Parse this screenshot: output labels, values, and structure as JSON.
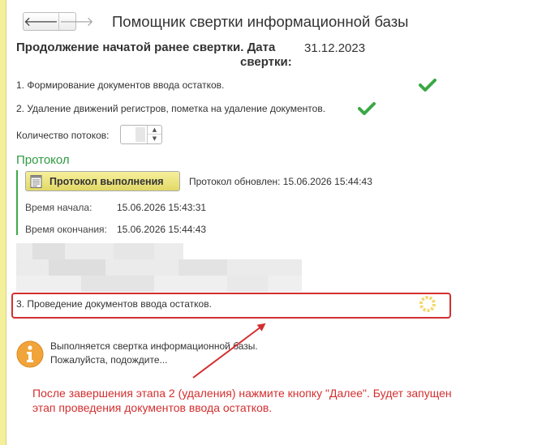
{
  "window": {
    "title": "Помощник свертки информационной базы",
    "nav": {
      "back_icon": "arrow-left-icon",
      "forward_icon": "arrow-right-icon",
      "back_glyph": "🡐",
      "forward_glyph": "🡒"
    }
  },
  "heading": {
    "line1": "Продолжение начатой ранее свертки. Дата",
    "date": "31.12.2023",
    "line2": "свертки:"
  },
  "steps": [
    {
      "label": "1. Формирование документов ввода остатков.",
      "status": "done"
    },
    {
      "label": "2. Удаление движений регистров, пометка на удаление документов.",
      "status": "done"
    }
  ],
  "threads": {
    "label": "Количество потоков:",
    "value": ""
  },
  "protocol": {
    "title": "Протокол",
    "button_label": "Протокол выполнения",
    "updated_text": "Протокол обновлен: 15.06.2026 15:44:43",
    "start_label": "Время начала:",
    "start_value": "15.06.2026 15:43:31",
    "end_label": "Время окончания:",
    "end_value": "15.06.2026 15:44:43"
  },
  "step3": {
    "label": "3. Проведение документов ввода остатков.",
    "status": "in-progress"
  },
  "info": {
    "line1": "Выполняется свертка информационной базы.",
    "line2": "Пожалуйста, подождите..."
  },
  "callout": {
    "line1": "После завершения этапа 2 (удаления) нажмите кнопку \"Далее\". Будет запущен",
    "line2": "этап проведения документов ввода остатков."
  },
  "colors": {
    "accent_green": "#2f9a41",
    "check_green": "#3aa845",
    "annotation_red": "#d32f2f",
    "button_yellow": "#efe684",
    "info_orange": "#f0a43a"
  }
}
